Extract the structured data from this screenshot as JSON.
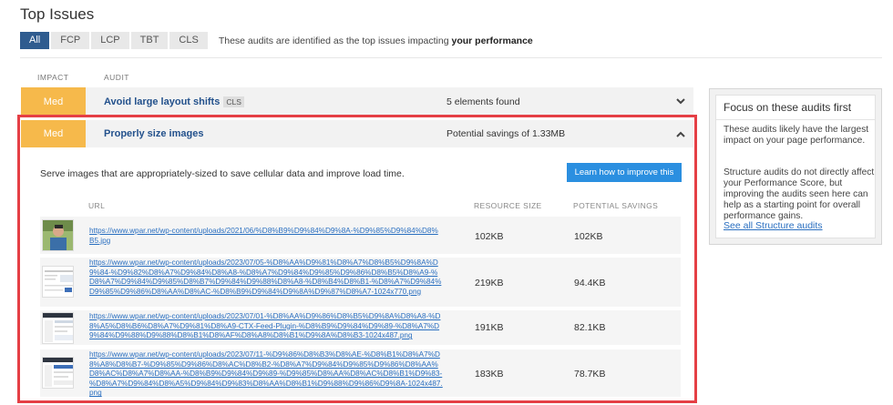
{
  "section": {
    "title": "Top Issues"
  },
  "filters": {
    "tabs": [
      "All",
      "FCP",
      "LCP",
      "TBT",
      "CLS"
    ],
    "desc_prefix": "These audits are identified as the top issues impacting ",
    "desc_bold": "your performance"
  },
  "columns": {
    "impact": "IMPACT",
    "audit": "AUDIT"
  },
  "audits": [
    {
      "impact": "Med",
      "name": "Avoid large layout shifts",
      "tag": "CLS",
      "meta": "5 elements found",
      "chevron": "⌄"
    },
    {
      "impact": "Med",
      "name": "Properly size images",
      "meta": "Potential savings of 1.33MB",
      "chevron": "⌃"
    }
  ],
  "detail": {
    "description": "Serve images that are appropriately-sized to save cellular data and improve load time.",
    "learn_button": "Learn how to improve this",
    "headers": {
      "url": "URL",
      "resource_size": "RESOURCE SIZE",
      "potential_savings": "POTENTIAL SAVINGS"
    },
    "rows": [
      {
        "url": "https://www.wpar.net/wp-content/uploads/2021/06/%D8%B9%D9%84%D9%8A-%D9%85%D9%84%D8%B5.jpg",
        "resource_size": "102KB",
        "potential_savings": "102KB"
      },
      {
        "url": "https://www.wpar.net/wp-content/uploads/2023/07/05-%D8%AA%D9%81%D8%A7%D8%B5%D9%8A%D9%84-%D9%82%D8%A7%D9%84%D8%A8-%D8%A7%D9%84%D9%85%D9%86%D8%B5%D8%A9-%D8%A7%D9%84%D9%85%D8%B7%D9%84%D9%88%D8%A8-%D8%B4%D8%B1-%D8%A7%D9%84%D9%85%D9%86%D8%AA%D8%AC-%D8%B9%D9%84%D9%8A%D9%87%D8%A7-1024x770.png",
        "resource_size": "219KB",
        "potential_savings": "94.4KB"
      },
      {
        "url": "https://www.wpar.net/wp-content/uploads/2023/07/01-%D8%AA%D9%86%D8%B5%D9%8A%D8%A8-%D8%A5%D8%B6%D8%A7%D9%81%D8%A9-CTX-Feed-Plugin-%D8%B9%D9%84%D9%89-%D8%A7%D9%84%D9%88%D9%88%D8%B1%D8%AF%D8%A8%D8%B1%D9%8A%D8%B3-1024x487.png",
        "resource_size": "191KB",
        "potential_savings": "82.1KB"
      },
      {
        "url": "https://www.wpar.net/wp-content/uploads/2023/07/11-%D9%86%D8%B3%D8%AE-%D8%B1%D8%A7%D8%A8%D8%B7-%D9%85%D9%86%D8%AC%D8%B2-%D8%A7%D9%84%D9%85%D9%86%D8%AA%D8%AC%D8%A7%D8%AA-%D8%B9%D9%84%D9%89-%D9%85%D8%AA%D8%AC%D8%B1%D9%83-%D8%A7%D9%84%D8%A5%D9%84%D9%83%D8%AA%D8%B1%D9%88%D9%86%D9%8A-1024x487.png",
        "resource_size": "183KB",
        "potential_savings": "78.7KB"
      }
    ]
  },
  "panel": {
    "title": "Focus on these audits first",
    "p1": "These audits likely have the largest impact on your page performance.",
    "p2": "Structure audits do not directly affect your Performance Score, but improving the audits seen here can help as a starting point for overall performance gains.",
    "link": "See all Structure audits"
  }
}
